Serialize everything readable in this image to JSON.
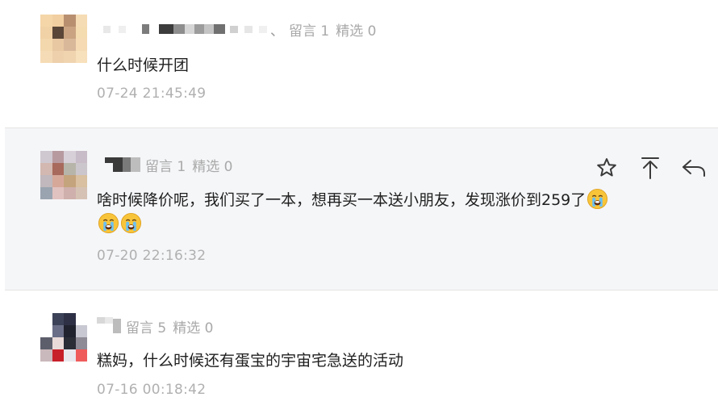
{
  "comments": [
    {
      "nickname_extra": "、",
      "messages_label": "留言 1",
      "featured_label": "精选 0",
      "text": "什么时候开团",
      "time": "07-24 21:45:49"
    },
    {
      "messages_label": "留言 1",
      "featured_label": "精选 0",
      "text": "啥时候降价呢，我们买了一本，想再买一本送小朋友，发现涨价到259了",
      "emoji_name": "crying-face-emoji",
      "time": "07-20 22:16:32",
      "actions": [
        "star-icon",
        "pin-to-top-icon",
        "reply-icon"
      ]
    },
    {
      "messages_label": "留言 5",
      "featured_label": "精选 0",
      "text": "糕妈，什么时候还有蛋宝的宇宙宅急送的活动",
      "time": "07-16 00:18:42"
    }
  ]
}
